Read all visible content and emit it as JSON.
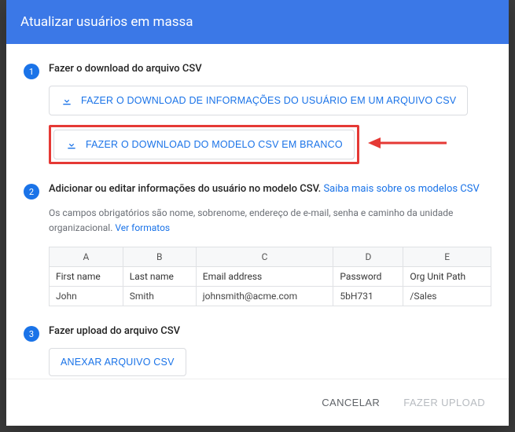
{
  "header": {
    "title": "Atualizar usuários em massa"
  },
  "steps": {
    "s1": {
      "num": "1",
      "title": "Fazer o download do arquivo CSV",
      "btn_download_info": "FAZER O DOWNLOAD DE INFORMAÇÕES DO USUÁRIO EM UM ARQUIVO CSV",
      "btn_download_blank": "FAZER O DOWNLOAD DO MODELO CSV EM BRANCO"
    },
    "s2": {
      "num": "2",
      "title_text": "Adicionar ou editar informações do usuário no modelo CSV.",
      "title_link": "Saiba mais sobre os modelos CSV",
      "desc_text": "Os campos obrigatórios são nome, sobrenome, endereço de e-mail, senha e caminho da unidade organizacional.",
      "desc_link": "Ver formatos",
      "cols": {
        "A": "A",
        "B": "B",
        "C": "C",
        "D": "D",
        "E": "E"
      },
      "headers": {
        "A": "First name",
        "B": "Last name",
        "C": "Email address",
        "D": "Password",
        "E": "Org Unit Path"
      },
      "row": {
        "A": "John",
        "B": "Smith",
        "C": "johnsmith@acme.com",
        "D": "5bH731",
        "E": "/Sales"
      }
    },
    "s3": {
      "num": "3",
      "title": "Fazer upload do arquivo CSV",
      "btn_attach": "ANEXAR ARQUIVO CSV"
    }
  },
  "footer": {
    "cancel": "CANCELAR",
    "upload": "FAZER UPLOAD"
  },
  "colors": {
    "accent": "#1a73e8",
    "header": "#3b78e7",
    "highlight": "#e53935"
  }
}
